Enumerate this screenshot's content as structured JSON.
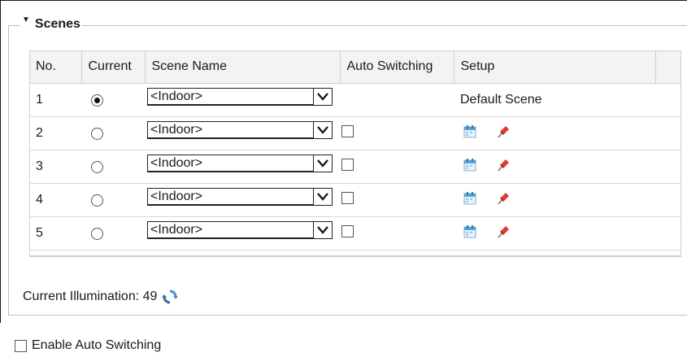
{
  "section": {
    "title": "Scenes"
  },
  "table": {
    "headers": {
      "no": "No.",
      "current": "Current",
      "scene_name": "Scene Name",
      "auto_switching": "Auto Switching",
      "setup": "Setup"
    },
    "rows": [
      {
        "no": "1",
        "current": true,
        "scene": "<Indoor>",
        "auto_switching": null,
        "setup_text": "Default Scene"
      },
      {
        "no": "2",
        "current": false,
        "scene": "<Indoor>",
        "auto_switching": false,
        "setup_text": null
      },
      {
        "no": "3",
        "current": false,
        "scene": "<Indoor>",
        "auto_switching": false,
        "setup_text": null
      },
      {
        "no": "4",
        "current": false,
        "scene": "<Indoor>",
        "auto_switching": false,
        "setup_text": null
      },
      {
        "no": "5",
        "current": false,
        "scene": "<Indoor>",
        "auto_switching": false,
        "setup_text": null
      }
    ]
  },
  "illumination": {
    "label": "Current Illumination: 49"
  },
  "enable_auto_switching": {
    "label": "Enable Auto Switching",
    "checked": false
  },
  "icons": {
    "calendar": "calendar-icon",
    "pin": "pin-icon",
    "refresh": "refresh-icon"
  }
}
